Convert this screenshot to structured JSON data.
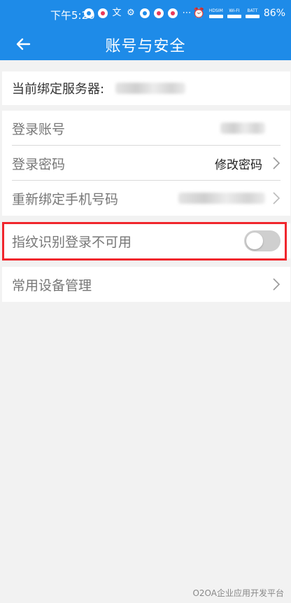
{
  "status_bar": {
    "time": "下午5:20",
    "hdsim_label": "HDSIM",
    "wifi_label": "WI-FI",
    "batt_label": "BATT",
    "battery": "86%"
  },
  "header": {
    "title": "账号与安全"
  },
  "server": {
    "label": "当前绑定服务器:"
  },
  "account": {
    "login_account_label": "登录账号",
    "login_password_label": "登录密码",
    "change_password_label": "修改密码",
    "rebind_phone_label": "重新绑定手机号码"
  },
  "fingerprint": {
    "label": "指纹识别登录不可用",
    "enabled": false
  },
  "devices": {
    "label": "常用设备管理"
  },
  "watermark": "O2OA企业应用开发平台",
  "colors": {
    "primary": "#1e8be8",
    "highlight": "#f0262d",
    "background": "#f2f2f2"
  }
}
